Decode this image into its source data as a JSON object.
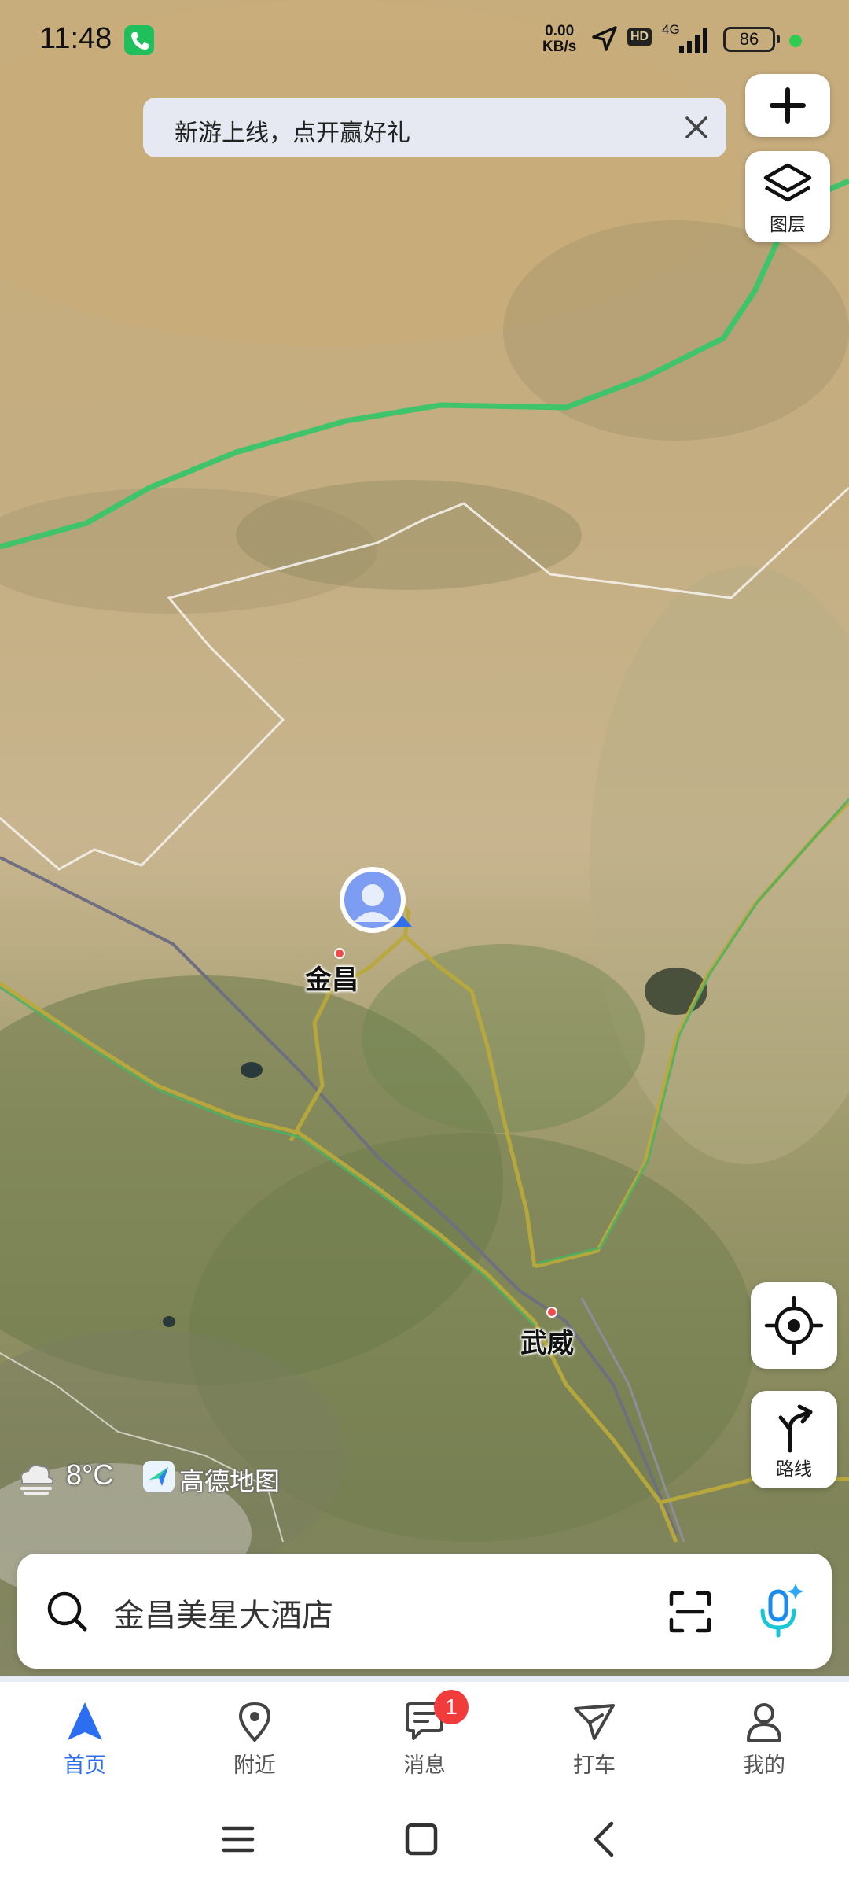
{
  "status_bar": {
    "time": "11:48",
    "net_speed_value": "0.00",
    "net_speed_unit": "KB/s",
    "hd_label": "HD",
    "network_type": "4G",
    "battery": "86"
  },
  "banner": {
    "text": "新游上线，点开赢好礼"
  },
  "map_controls": {
    "layers_label": "图层",
    "route_label": "路线"
  },
  "map": {
    "cities": [
      {
        "name": "金昌"
      },
      {
        "name": "武威"
      }
    ],
    "weather_temp": "8°C",
    "brand": "高德地图"
  },
  "search": {
    "placeholder": "金昌美星大酒店"
  },
  "tabs": [
    {
      "label": "首页",
      "icon": "home-arrow-icon",
      "active": true
    },
    {
      "label": "附近",
      "icon": "location-pin-icon"
    },
    {
      "label": "消息",
      "icon": "message-icon",
      "badge": "1"
    },
    {
      "label": "打车",
      "icon": "taxi-icon"
    },
    {
      "label": "我的",
      "icon": "profile-icon"
    }
  ],
  "colors": {
    "accent": "#2c6ef2",
    "route_green": "#3fc46b",
    "badge_red": "#f23c3c"
  }
}
